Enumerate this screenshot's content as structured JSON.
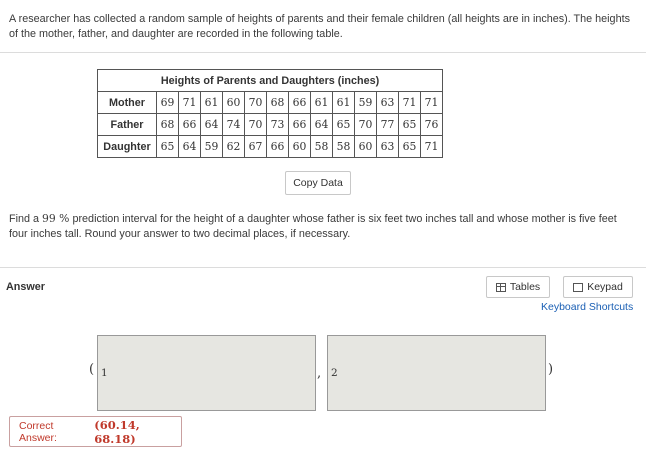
{
  "prompt": "A researcher has collected a random sample of heights of parents and their female children (all heights are in inches). The heights of the mother, father, and daughter are recorded in the following table.",
  "table": {
    "caption": "Heights of Parents and Daughters (inches)",
    "rows": [
      {
        "label": "Mother",
        "values": [
          "69",
          "71",
          "61",
          "60",
          "70",
          "68",
          "66",
          "61",
          "61",
          "59",
          "63",
          "71",
          "71"
        ]
      },
      {
        "label": "Father",
        "values": [
          "68",
          "66",
          "64",
          "74",
          "70",
          "73",
          "66",
          "64",
          "65",
          "70",
          "77",
          "65",
          "76"
        ]
      },
      {
        "label": "Daughter",
        "values": [
          "65",
          "64",
          "59",
          "62",
          "67",
          "66",
          "60",
          "58",
          "58",
          "60",
          "63",
          "65",
          "71"
        ]
      }
    ]
  },
  "copy_data_label": "Copy Data",
  "question": {
    "pre": "Find a",
    "confidence": "99 %",
    "post": "prediction interval for the height of a daughter whose father is six feet two inches tall and whose mother is five feet four inches tall. Round your answer to two decimal places, if necessary."
  },
  "answer_label": "Answer",
  "tools": {
    "tables_label": "Tables",
    "keypad_label": "Keypad",
    "shortcuts_label": "Keyboard Shortcuts"
  },
  "answer_fields": {
    "open_paren": "(",
    "field1_value": "1",
    "separator": ",",
    "field2_value": "2",
    "close_paren": ")"
  },
  "correct_answer": {
    "label": "Correct Answer:",
    "value": "(60.14, 68.18)"
  },
  "colors": {
    "accent_link": "#1a5fb4",
    "correct_text": "#c0392b",
    "input_bg": "#e6e6e1"
  }
}
